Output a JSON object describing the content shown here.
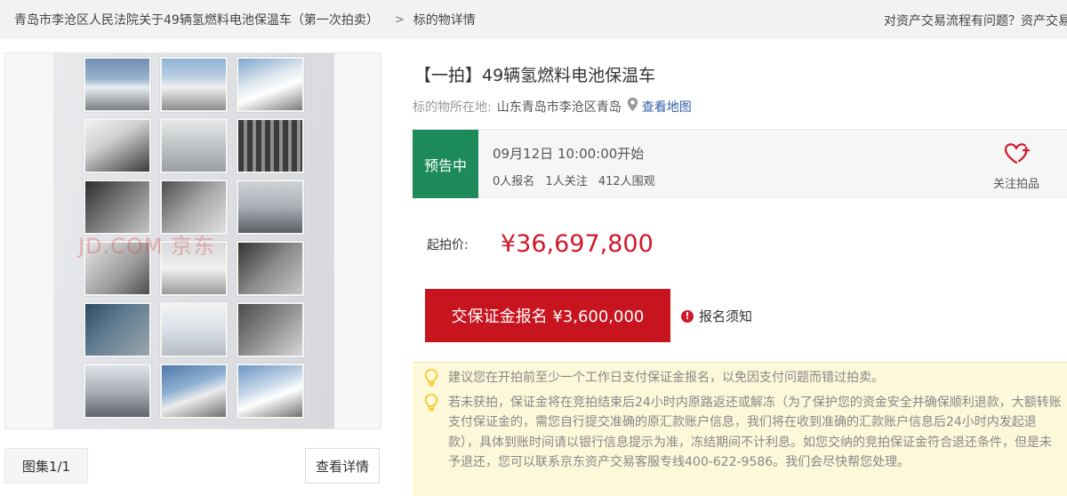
{
  "breadcrumb": {
    "auction_title": "青岛市李沧区人民法院关于49辆氢燃料电池保温车（第一次拍卖）",
    "separator": ">",
    "current": "标的物详情"
  },
  "help_link": "对资产交易流程有问题？资产交易",
  "gallery": {
    "watermark": "JD.COM 京东",
    "album_label": "图集1/1",
    "detail_button": "查看详情"
  },
  "item": {
    "title": "【一拍】49辆氢燃料电池保温车",
    "location_label": "标的物所在地:",
    "location_value": "山东青岛市李沧区青岛",
    "map_link": "查看地图"
  },
  "status": {
    "badge": "预告中",
    "start_time": "09月12日 10:00:00开始",
    "registrations": "0人报名",
    "followers": "1人关注",
    "watchers": "412人围观",
    "follow_label": "关注拍品"
  },
  "price": {
    "label": "起拍价:",
    "value": "¥36,697,800"
  },
  "deposit": {
    "button_label": "交保证金报名 ¥3,600,000",
    "notice_label": "报名须知"
  },
  "tips": [
    "建议您在开拍前至少一个工作日支付保证金报名，以免因支付问题而错过拍卖。",
    "若未获拍，保证金将在竞拍结束后24小时内原路返还或解冻（为了保护您的资金安全并确保顺利退款，大额转账支付保证金的，需您自行提交准确的原汇款账户信息，我们将在收到准确的汇款账户信息后24小时内发起退款），具体到账时间请以银行信息提示为准，冻结期间不计利息。如您交纳的竞拍保证金符合退还条件，但是未予退还，您可以联系京东资产交易客服专线400-622-9586。我们会尽快帮您处理。"
  ],
  "colors": {
    "accent_red": "#c8141f",
    "price_red": "#d0182a",
    "status_green": "#1d8a5a",
    "link_blue": "#2f5ea8",
    "tips_bg": "#fdf8d9"
  },
  "icons": {
    "location": "map-pin-icon",
    "follow": "heart-plus-icon",
    "notice": "exclamation-circle-icon",
    "tip": "lightbulb-icon"
  }
}
